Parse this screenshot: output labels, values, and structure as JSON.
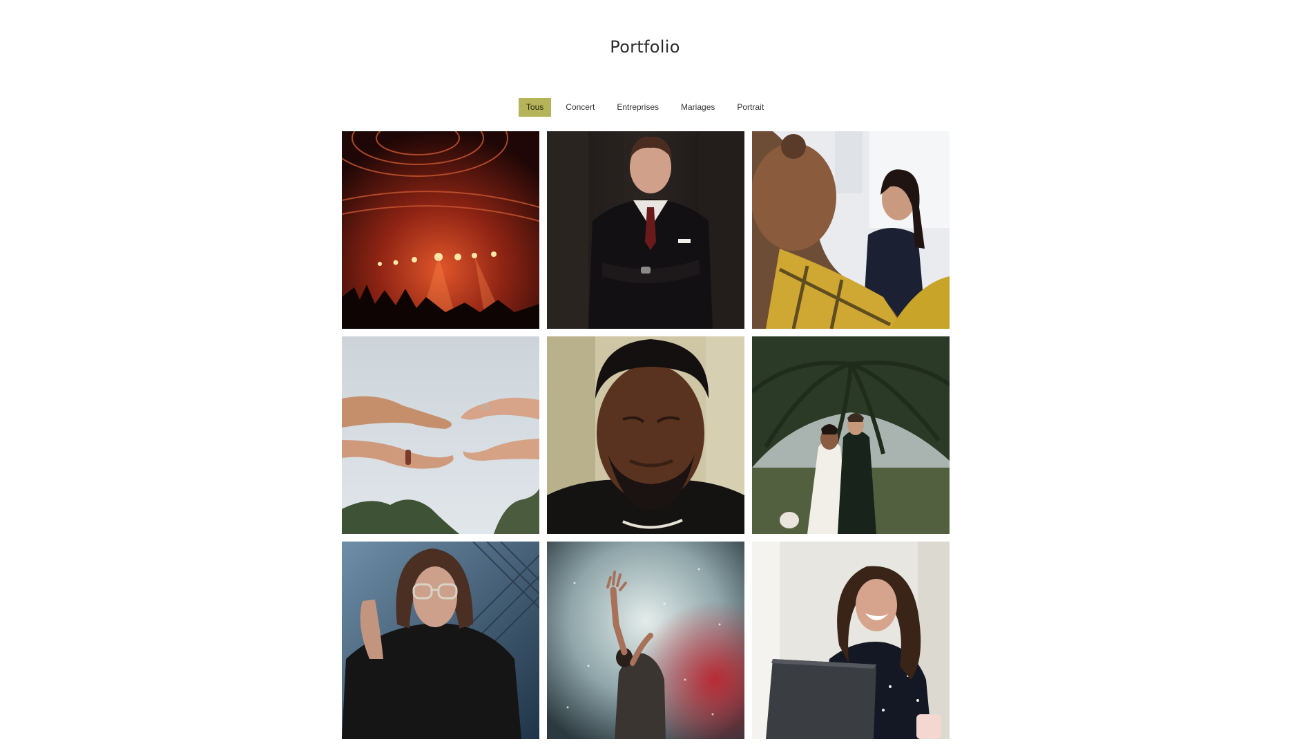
{
  "page": {
    "title": "Portfolio",
    "accent_color": "#b5b45a"
  },
  "filters": {
    "active_index": 0,
    "items": [
      {
        "label": "Tous"
      },
      {
        "label": "Concert"
      },
      {
        "label": "Entreprises"
      },
      {
        "label": "Mariages"
      },
      {
        "label": "Portrait"
      }
    ]
  },
  "gallery": {
    "items": [
      {
        "subject": "concert-stage-lights",
        "category": "Concert"
      },
      {
        "subject": "businessman-in-suit",
        "category": "Entreprises"
      },
      {
        "subject": "office-meeting-smiling-woman",
        "category": "Entreprises"
      },
      {
        "subject": "wedding-hands-ring",
        "category": "Mariages"
      },
      {
        "subject": "man-portrait-eyes-closed",
        "category": "Portrait"
      },
      {
        "subject": "wedding-couple-palm-tree",
        "category": "Mariages"
      },
      {
        "subject": "woman-with-glasses-portrait",
        "category": "Portrait"
      },
      {
        "subject": "singer-raised-hand-smoke",
        "category": "Concert"
      },
      {
        "subject": "laughing-woman-laptop",
        "category": "Entreprises"
      }
    ]
  }
}
